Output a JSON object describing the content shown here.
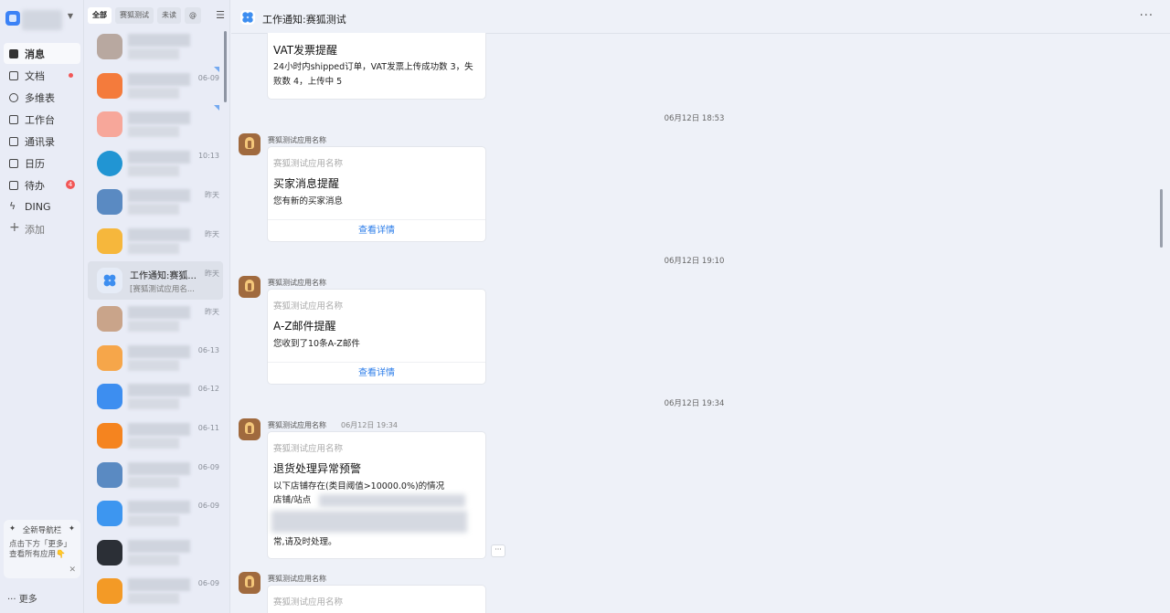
{
  "leftnav": {
    "items": [
      {
        "label": "消息",
        "icon": "message-icon",
        "active": true
      },
      {
        "label": "文档",
        "icon": "document-icon",
        "dot": true
      },
      {
        "label": "多维表",
        "icon": "table-icon"
      },
      {
        "label": "工作台",
        "icon": "workbench-icon"
      },
      {
        "label": "通讯录",
        "icon": "contacts-icon"
      },
      {
        "label": "日历",
        "icon": "calendar-icon"
      },
      {
        "label": "待办",
        "icon": "todo-icon",
        "badge": "4"
      },
      {
        "label": "DING",
        "icon": "ding-icon"
      },
      {
        "label": "添加",
        "icon": "plus-icon"
      }
    ],
    "tip": {
      "title": "全新导航栏",
      "body": "点击下方「更多」查看所有应用",
      "emoji": "👇"
    },
    "more_label": "更多"
  },
  "convlist": {
    "filters": [
      "全部",
      "赛狐测试",
      "未读",
      "@"
    ],
    "items": [
      {
        "time": "",
        "avatar_color": "#b8a8a0"
      },
      {
        "time": "06-09",
        "avatar_color": "#f47b3c",
        "corner": true
      },
      {
        "time": "",
        "avatar_color": "#f7a79a",
        "corner": true
      },
      {
        "time": "10:13",
        "avatar_color": "#2195d3"
      },
      {
        "time": "昨天",
        "avatar_color": "#5a8ac2"
      },
      {
        "time": "昨天",
        "avatar_color": "#f6b73c"
      },
      {
        "time": "昨天",
        "title": "工作通知:赛狐...",
        "sub": "[赛狐测试应用名...",
        "avatar_color": "#e6ecf7",
        "active": true
      },
      {
        "time": "昨天",
        "avatar_color": "#c9a48a"
      },
      {
        "time": "06-13",
        "avatar_color": "#f6a64a"
      },
      {
        "time": "06-12",
        "avatar_color": "#3d8ef0"
      },
      {
        "time": "06-11",
        "avatar_color": "#f5841f"
      },
      {
        "time": "06-09",
        "avatar_color": "#5a8ac2"
      },
      {
        "time": "06-09",
        "avatar_color": "#3d96f0"
      },
      {
        "time": "",
        "avatar_color": "#2b2f36"
      },
      {
        "time": "06-09",
        "avatar_color": "#f39a26"
      }
    ]
  },
  "chat": {
    "title": "工作通知:赛狐测试",
    "more": "···",
    "messages": [
      {
        "partial_top": true,
        "card_title": "VAT发票提醒",
        "card_body": "24小时内shipped订单，VAT发票上传成功数 3，失败数 4，上传中 5"
      },
      {
        "timestamp": "06月12日 18:53",
        "sender": "赛狐测试应用名称",
        "card_app": "赛狐测试应用名称",
        "card_title": "买家消息提醒",
        "card_body": "您有新的买家消息",
        "link": "查看详情"
      },
      {
        "timestamp": "06月12日 19:10",
        "sender": "赛狐测试应用名称",
        "card_app": "赛狐测试应用名称",
        "card_title": "A-Z邮件提醒",
        "card_body": "您收到了10条A-Z邮件",
        "link": "查看详情"
      },
      {
        "timestamp": "06月12日 19:34",
        "sender": "赛狐测试应用名称",
        "inline_time": "06月12日 19:34",
        "card_app": "赛狐测试应用名称",
        "card_title": "退货处理异常预警",
        "card_line1": "以下店铺存在(类目阈值>10000.0%)的情况",
        "card_line2": "店铺/站点",
        "card_tail": "常,请及时处理。",
        "more_btn": "···"
      },
      {
        "sender": "赛狐测试应用名称",
        "card_app": "赛狐测试应用名称"
      }
    ]
  }
}
